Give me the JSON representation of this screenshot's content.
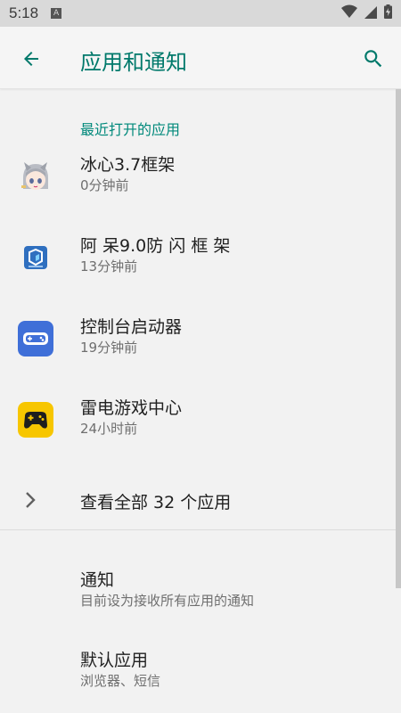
{
  "status_bar": {
    "time": "5:18",
    "notification_badge": "A",
    "icons": [
      "wifi-icon",
      "cell-signal-icon",
      "battery-charging-icon"
    ]
  },
  "app_bar": {
    "title": "应用和通知",
    "back_icon": "arrow-back-icon",
    "search_icon": "search-icon",
    "accent_color": "#00796b"
  },
  "recent": {
    "heading": "最近打开的应用",
    "apps": [
      {
        "name": "冰心3.7框架",
        "time": "0分钟前",
        "icon": "anime-avatar-icon"
      },
      {
        "name": "阿 呆9.0防 闪 框 架",
        "time": "13分钟前",
        "icon": "blue-cube-app-icon"
      },
      {
        "name": "控制台启动器",
        "time": "19分钟前",
        "icon": "console-gamepad-icon"
      },
      {
        "name": "雷电游戏中心",
        "time": "24小时前",
        "icon": "yellow-gamepad-icon"
      }
    ]
  },
  "see_all": {
    "label": "查看全部 32 个应用",
    "icon": "chevron-right-icon"
  },
  "prefs": [
    {
      "name": "通知",
      "summary": "目前设为接收所有应用的通知"
    },
    {
      "name": "默认应用",
      "summary": "浏览器、短信"
    }
  ]
}
